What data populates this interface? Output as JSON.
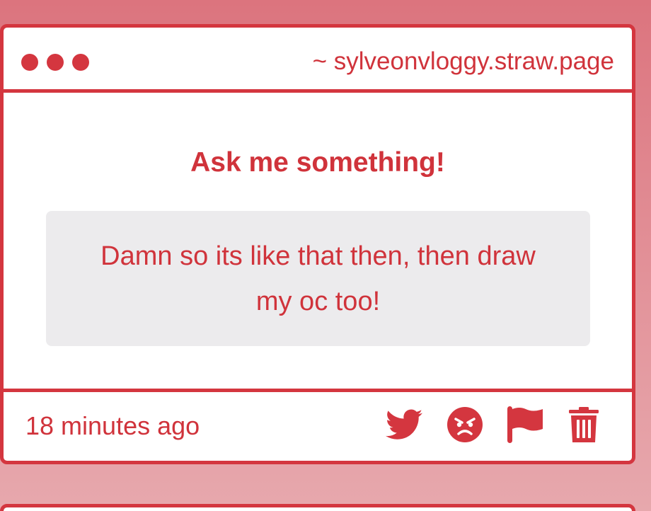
{
  "window": {
    "url": "~ sylveonvloggy.straw.page"
  },
  "main": {
    "heading": "Ask me something!",
    "message": "Damn so its like that then, then draw my oc too!"
  },
  "footer": {
    "timestamp": "18 minutes ago",
    "actions": [
      {
        "icon": "twitter-icon"
      },
      {
        "icon": "angry-face-icon"
      },
      {
        "icon": "flag-icon"
      },
      {
        "icon": "trash-icon"
      }
    ]
  },
  "colors": {
    "accent": "#d4363f",
    "background_top": "#dc747e",
    "background_bottom": "#e7a8ad",
    "message_box": "#ecebed",
    "card": "#ffffff"
  }
}
